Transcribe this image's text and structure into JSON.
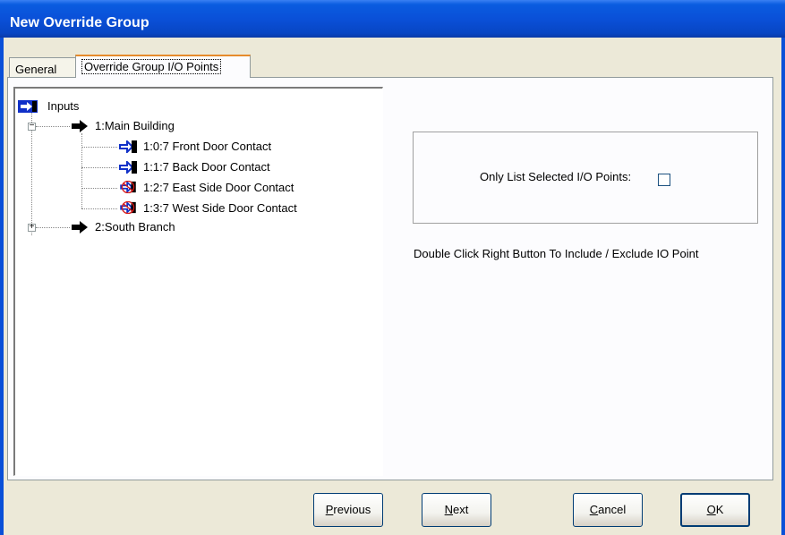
{
  "window": {
    "title": "New Override Group"
  },
  "tabs": [
    {
      "label": "General"
    },
    {
      "label": "Override Group I/O Points"
    }
  ],
  "tree": {
    "root": "Inputs",
    "nodes": [
      {
        "label": "1:Main Building",
        "expanded": true
      },
      {
        "label": "1:0:7  Front Door Contact",
        "excluded": false
      },
      {
        "label": "1:1:7  Back Door Contact",
        "excluded": false
      },
      {
        "label": "1:2:7  East Side Door Contact",
        "excluded": true
      },
      {
        "label": "1:3:7  West Side Door Contact",
        "excluded": true
      },
      {
        "label": "2:South Branch",
        "expanded": false
      }
    ]
  },
  "filter": {
    "label": "Only List Selected I/O Points:",
    "checked": false
  },
  "hint": "Double Click Right Button To Include / Exclude IO Point",
  "buttons": {
    "previous": {
      "mnemonic": "P",
      "rest": "revious"
    },
    "next": {
      "mnemonic": "N",
      "rest": "ext"
    },
    "cancel": {
      "mnemonic": "C",
      "rest": "ancel"
    },
    "ok": {
      "mnemonic": "O",
      "rest": "K"
    }
  },
  "colors": {
    "titlebar": "#0a50d8",
    "io_icon": "#1030c8",
    "exclude_mark": "#d81818"
  },
  "icons": {
    "io_point": "io-point-icon",
    "building": "arrow-right-icon"
  }
}
